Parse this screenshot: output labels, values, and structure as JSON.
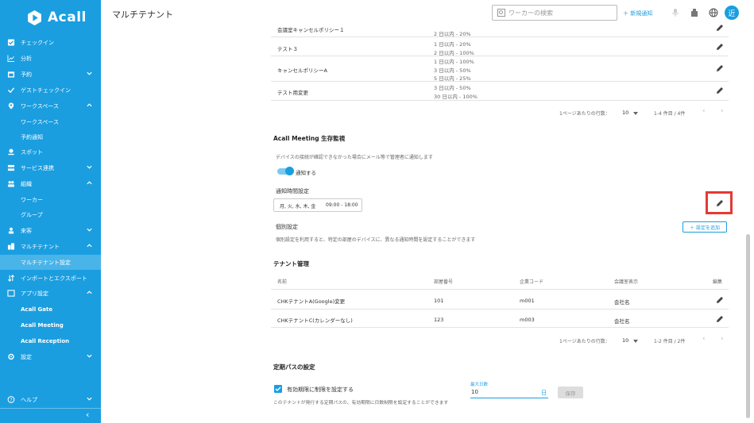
{
  "app": {
    "brand": "Acall",
    "page_title": "マルチテナント"
  },
  "header": {
    "search_placeholder": "ワーカーの検索",
    "new_notice": "＋ 新規通知",
    "avatar": "近"
  },
  "sidebar": {
    "items": [
      {
        "label": "チェックイン"
      },
      {
        "label": "分析"
      },
      {
        "label": "予約"
      },
      {
        "label": "ゲストチェックイン"
      },
      {
        "label": "ワークスペース"
      },
      {
        "label": "ワークスペース"
      },
      {
        "label": "予約通知"
      },
      {
        "label": "スポット"
      },
      {
        "label": "サービス連携"
      },
      {
        "label": "組織"
      },
      {
        "label": "ワーカー"
      },
      {
        "label": "グループ"
      },
      {
        "label": "来客"
      },
      {
        "label": "マルチテナント"
      },
      {
        "label": "マルチテナント設定"
      },
      {
        "label": "インポートとエクスポート"
      },
      {
        "label": "アプリ設定"
      },
      {
        "label": "Acall Gate"
      },
      {
        "label": "Acall Meeting"
      },
      {
        "label": "Acall Reception"
      },
      {
        "label": "設定"
      },
      {
        "label": "ヘルプ"
      }
    ],
    "collapse": "‹"
  },
  "cancel_policies": {
    "rows": [
      {
        "name": "会議室キャンセルポリシー１",
        "rules": [
          "",
          "2 日以内 - 20%"
        ]
      },
      {
        "name": "テスト３",
        "rules": [
          "1 日以内 - 20%",
          "2 日以内 - 100%"
        ]
      },
      {
        "name": "キャンセルポリシーA",
        "rules": [
          "1 日以内 - 100%",
          "3 日以内 - 50%",
          "5 日以内 - 25%"
        ]
      },
      {
        "name": "テスト用変更",
        "rules": [
          "3 日以内 - 50%",
          "30 日以内 - 100%"
        ]
      }
    ],
    "pagination": {
      "rows_per_page_label": "1ページあたりの行数：",
      "rows_per_page": "10",
      "range": "1-4 件目 / 4件"
    }
  },
  "meeting_monitor": {
    "title": "Acall Meeting 生存監視",
    "description": "デバイスの接続が確認できなかった場合にメール等で管理者に通知します",
    "toggle_label": "通知する",
    "notify_time_title": "通知時間設定",
    "notify_days": "月, 火, 水, 木, 金",
    "notify_hours": "09:00 - 18:00",
    "individual_title": "個別設定",
    "individual_description": "個別設定を利用すると、特定の部屋のデバイスに、異なる通知時間を設定することができます",
    "add_button": "＋ 設定を追加"
  },
  "tenants": {
    "title": "テナント管理",
    "columns": [
      "名前",
      "部屋番号",
      "企業コード",
      "会議室表示",
      "編集"
    ],
    "rows": [
      {
        "name": "CHKテナントA(Google)変更",
        "room": "101",
        "code": "m001",
        "display": "会社名"
      },
      {
        "name": "CHKテナントC(カレンダーなし)",
        "room": "123",
        "code": "m003",
        "display": "会社名"
      }
    ],
    "pagination": {
      "rows_per_page_label": "1ページあたりの行数：",
      "rows_per_page": "10",
      "range": "1-2 件目 / 2件"
    }
  },
  "pass_settings": {
    "title": "定期パスの設定",
    "checkbox_label": "有効期限に制限を設定する",
    "description": "このテナントが発行する定期パスの、有効期限に日数制限を設定することができます",
    "max_days_label": "最大日数",
    "max_days_value": "10",
    "unit": "日",
    "save": "保存"
  },
  "colors": {
    "brand": "#1a9ee0",
    "highlight": "#e53935"
  }
}
